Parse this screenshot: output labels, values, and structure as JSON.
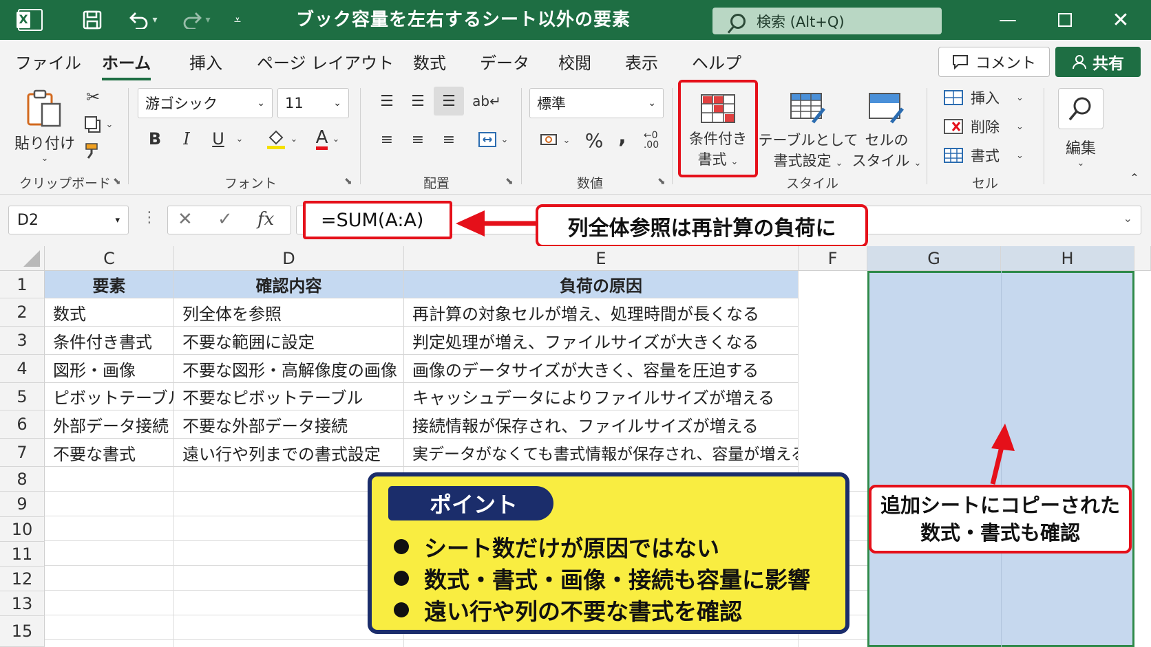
{
  "window": {
    "title": "ブック容量を左右するシート以外の要素",
    "search_placeholder": "検索 (Alt+Q)",
    "app_icon": "excel-icon"
  },
  "ribbon_tabs": [
    "ファイル",
    "ホーム",
    "挿入",
    "ページ レイアウト",
    "数式",
    "データ",
    "校閲",
    "表示",
    "ヘルプ"
  ],
  "active_tab": "ホーム",
  "header_buttons": {
    "comment": "コメント",
    "share": "共有"
  },
  "ribbon": {
    "clipboard": {
      "paste": "貼り付け",
      "label": "クリップボード"
    },
    "font": {
      "name": "游ゴシック",
      "size": "11",
      "bold": "B",
      "italic": "I",
      "underline": "U",
      "font_color": "A",
      "label": "フォント"
    },
    "alignment": {
      "label": "配置"
    },
    "number": {
      "format": "標準",
      "percent": "%",
      "comma": ",",
      "label": "数値"
    },
    "styles": {
      "conditional_line1": "条件付き",
      "conditional_line2": "書式",
      "table_line1": "テーブルとして",
      "table_line2": "書式設定",
      "cell_styles_line1": "セルの",
      "cell_styles_line2": "スタイル",
      "label": "スタイル"
    },
    "cells": {
      "insert": "挿入",
      "delete": "削除",
      "format": "書式",
      "label": "セル"
    },
    "editing": {
      "label": "編集"
    }
  },
  "formula_bar": {
    "name_box": "D2",
    "formula": "=SUM(A:A)",
    "cancel": "✕",
    "enter": "✓",
    "fx": "fx"
  },
  "callouts": {
    "formula_note": "列全体参照は再計算の負荷に",
    "copy_note_line1": "追加シートにコピーされた",
    "copy_note_line2": "数式・書式も確認"
  },
  "columns": [
    "C",
    "D",
    "E",
    "F",
    "G",
    "H"
  ],
  "rows": [
    "1",
    "2",
    "3",
    "4",
    "5",
    "6",
    "7",
    "8",
    "9",
    "10",
    "11",
    "12",
    "13",
    "15"
  ],
  "table": {
    "headers": [
      "要素",
      "確認内容",
      "負荷の原因"
    ],
    "rows": [
      [
        "数式",
        "列全体を参照",
        "再計算の対象セルが増え、処理時間が長くなる"
      ],
      [
        "条件付き書式",
        "不要な範囲に設定",
        "判定処理が増え、ファイルサイズが大きくなる"
      ],
      [
        "図形・画像",
        "不要な図形・高解像度の画像",
        "画像のデータサイズが大きく、容量を圧迫する"
      ],
      [
        "ピボットテーブル",
        "不要なピボットテーブル",
        "キャッシュデータによりファイルサイズが増える"
      ],
      [
        "外部データ接続",
        "不要な外部データ接続",
        "接続情報が保存され、ファイルサイズが増える"
      ],
      [
        "不要な書式",
        "遠い行や列までの書式設定",
        "実データがなくても書式情報が保存され、容量が増える"
      ]
    ]
  },
  "point": {
    "title": "ポイント",
    "items": [
      "シート数だけが原因ではない",
      "数式・書式・画像・接続も容量に影響",
      "遠い行や列の不要な書式を確認"
    ]
  },
  "colors": {
    "excel_green": "#1e6e43",
    "callout_red": "#e5101a",
    "header_blue": "#c5d9f1",
    "selection_blue": "#c6d8ee",
    "point_yellow": "#f9ed41",
    "point_navy": "#1b2d6b"
  }
}
